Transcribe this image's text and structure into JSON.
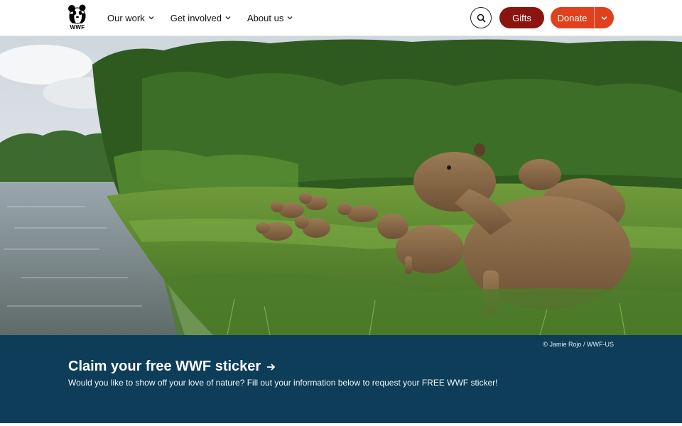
{
  "header": {
    "logo_text": "WWF",
    "nav": [
      {
        "label": "Our work"
      },
      {
        "label": "Get involved"
      },
      {
        "label": "About us"
      }
    ],
    "gifts_label": "Gifts",
    "donate_label": "Donate"
  },
  "hero": {
    "subject": "capybaras by a river"
  },
  "banner": {
    "credit": "© Jamie Rojo / WWF-US",
    "title": "Claim your free WWF sticker",
    "description": "Would you like to show off your love of nature? Fill out your information below to request your FREE WWF sticker!"
  },
  "colors": {
    "gifts": "#8a1410",
    "donate": "#e0401d",
    "banner": "#0d3d59"
  }
}
